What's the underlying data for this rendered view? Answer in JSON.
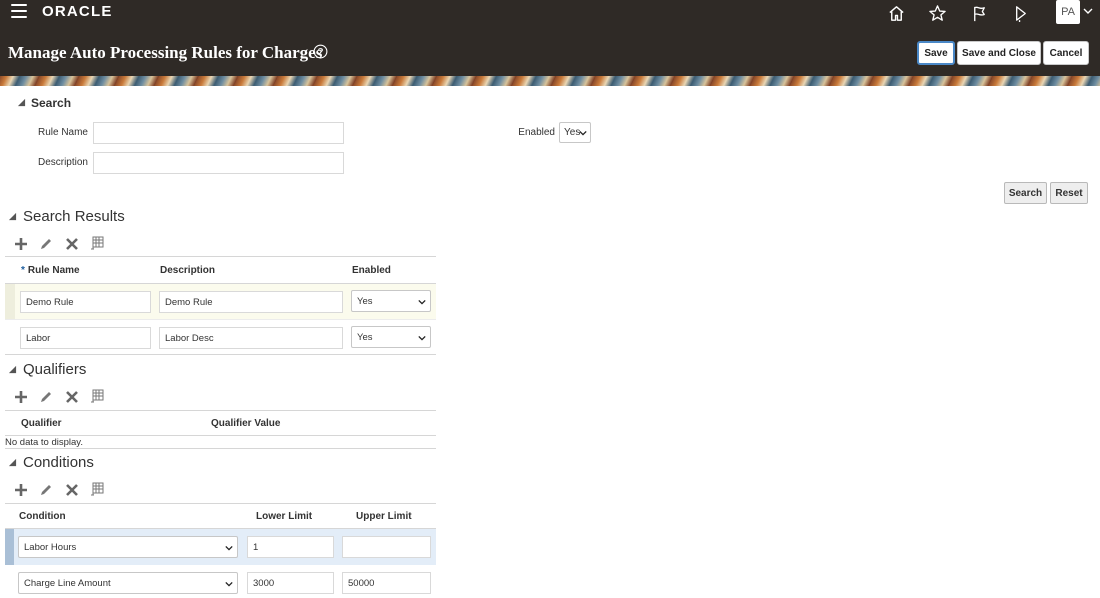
{
  "header": {
    "logo": "ORACLE",
    "user_initials": "PA",
    "icons": [
      "hamburger-icon",
      "home-icon",
      "star-icon",
      "flag-icon",
      "bell-icon",
      "chevron-down-icon"
    ]
  },
  "page": {
    "title": "Manage Auto Processing Rules for Charges",
    "buttons": {
      "save": "Save",
      "save_and_close": "Save and Close",
      "cancel": "Cancel"
    }
  },
  "search": {
    "title": "Search",
    "rule_name_label": "Rule Name",
    "rule_name_value": "",
    "description_label": "Description",
    "description_value": "",
    "enabled_label": "Enabled",
    "enabled_value": "Yes",
    "search_button": "Search",
    "reset_button": "Reset"
  },
  "results": {
    "title": "Search Results",
    "columns": {
      "rule_name": "Rule Name",
      "description": "Description",
      "enabled": "Enabled"
    },
    "rows": [
      {
        "rule_name": "Demo Rule",
        "description": "Demo Rule",
        "enabled": "Yes"
      },
      {
        "rule_name": "Labor",
        "description": "Labor Desc",
        "enabled": "Yes"
      }
    ]
  },
  "qualifiers": {
    "title": "Qualifiers",
    "columns": {
      "qualifier": "Qualifier",
      "qualifier_value": "Qualifier Value"
    },
    "empty_text": "No data to display."
  },
  "conditions": {
    "title": "Conditions",
    "columns": {
      "condition": "Condition",
      "lower_limit": "Lower Limit",
      "upper_limit": "Upper Limit"
    },
    "rows": [
      {
        "condition": "Labor Hours",
        "lower_limit": "1",
        "upper_limit": ""
      },
      {
        "condition": "Charge Line Amount",
        "lower_limit": "3000",
        "upper_limit": "50000"
      }
    ]
  },
  "colors": {
    "header_bg": "#2f2a26",
    "primary_border": "#4a88c7",
    "selected_row": "#fbfbed",
    "active_row": "#e3edf8"
  }
}
